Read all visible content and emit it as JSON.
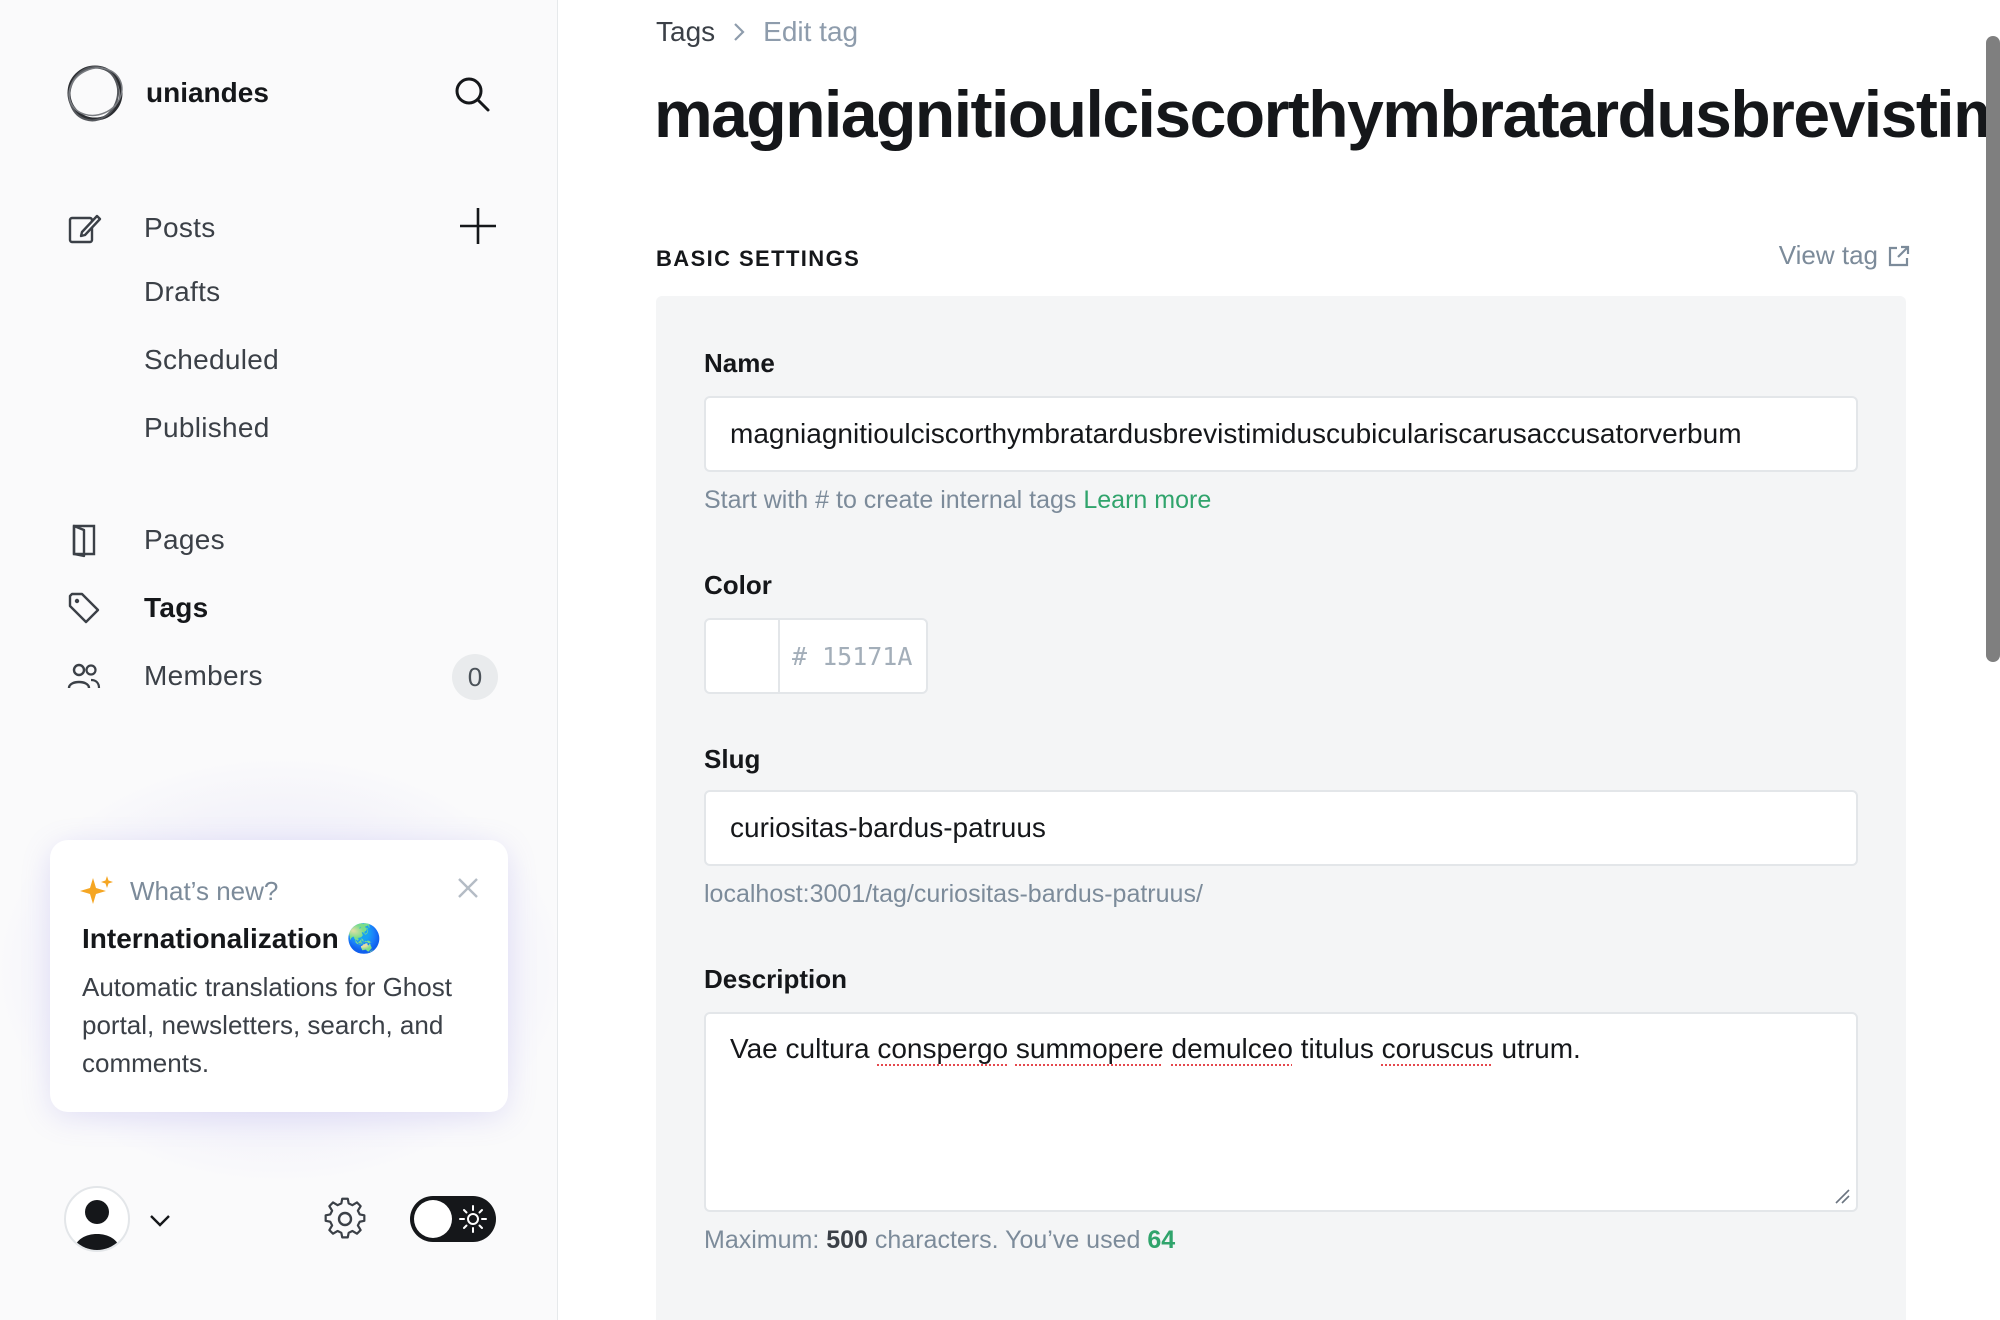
{
  "sidebar": {
    "site_name": "uniandes",
    "nav": {
      "posts": "Posts",
      "drafts": "Drafts",
      "scheduled": "Scheduled",
      "published": "Published",
      "pages": "Pages",
      "tags": "Tags",
      "members": "Members",
      "members_count": "0"
    },
    "whats_new": {
      "kicker": "What’s new?",
      "title": "Internationalization 🌏",
      "body": "Automatic translations for Ghost portal, newsletters, search, and comments."
    }
  },
  "breadcrumb": {
    "parent": "Tags",
    "current": "Edit tag"
  },
  "page_title": "magniagnitioulciscorthymbratardusbrevistimiduscubiculariscarusaccusatorverbum",
  "section": {
    "title": "BASIC SETTINGS",
    "view_link": "View tag"
  },
  "form": {
    "name_label": "Name",
    "name_value": "magniagnitioulciscorthymbratardusbrevistimiduscubiculariscarusaccusatorverbum",
    "name_hint": "Start with # to create internal tags",
    "name_hint_link": "Learn more",
    "color_label": "Color",
    "color_placeholder": "# 15171A",
    "slug_label": "Slug",
    "slug_value": "curiositas-bardus-patruus",
    "slug_url": "localhost:3001/tag/curiositas-bardus-patruus/",
    "description_label": "Description",
    "description": {
      "w1": "Vae cultura",
      "w2": "conspergo",
      "w3": "summopere",
      "w4": "demulceo",
      "w5": "titulus",
      "w6": "coruscus",
      "w7": "utrum."
    },
    "counter_prefix": "Maximum:",
    "counter_max": "500",
    "counter_mid": "characters. You’ve used",
    "counter_used": "64"
  },
  "colors": {
    "accent_green": "#30a46c",
    "text_dark": "#15171a",
    "muted": "#7c8b9a"
  }
}
